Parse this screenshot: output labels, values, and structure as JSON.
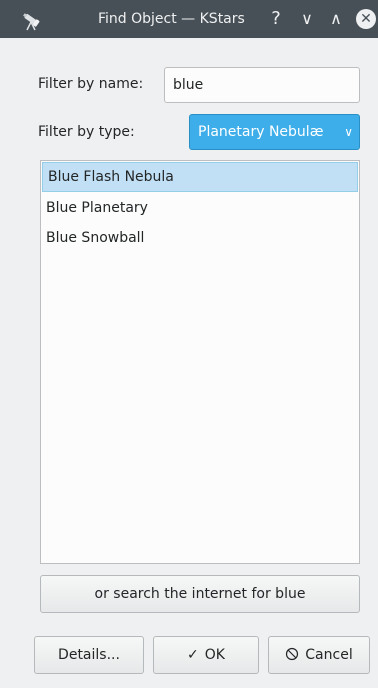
{
  "window": {
    "title": "Find Object — KStars",
    "icon": "telescope-icon",
    "help_glyph": "?",
    "minimize_glyph": "∨",
    "maximize_glyph": "∧",
    "close_glyph": "✕"
  },
  "filter_name": {
    "label": "Filter by name:",
    "value": "blue"
  },
  "filter_type": {
    "label": "Filter by type:",
    "selected": "Planetary Nebulæ",
    "accent_color": "#3daee9"
  },
  "results": {
    "items": [
      {
        "label": "Blue Flash Nebula",
        "selected": true
      },
      {
        "label": "Blue Planetary",
        "selected": false
      },
      {
        "label": "Blue Snowball",
        "selected": false
      }
    ]
  },
  "buttons": {
    "search_internet": "or search the internet for blue",
    "details": "Details...",
    "ok": "OK",
    "ok_icon": "✓",
    "cancel": "Cancel",
    "cancel_icon": "⃠"
  }
}
